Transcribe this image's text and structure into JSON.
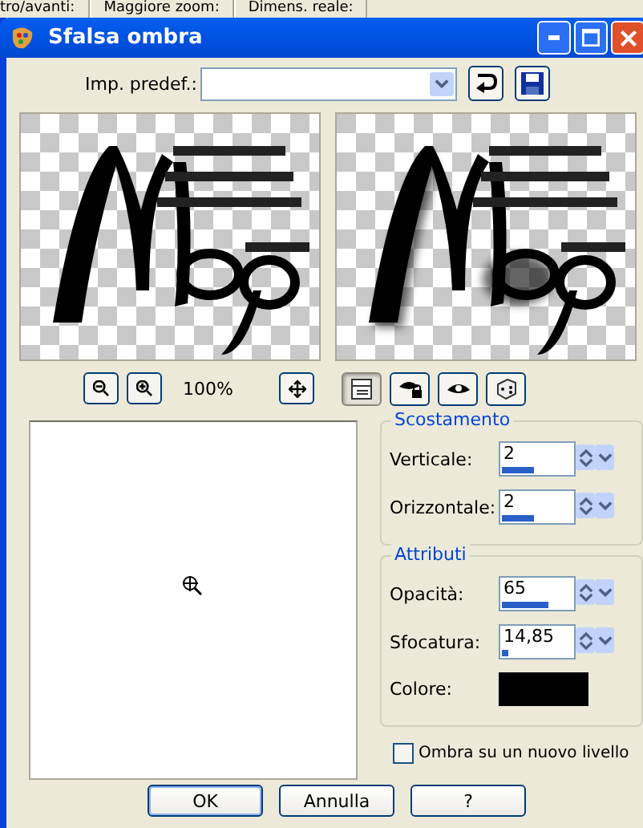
{
  "background_toolbar": [
    "tro/avanti:",
    "Maggiore zoom:",
    "Dimens. reale:"
  ],
  "window": {
    "title": "Sfalsa ombra"
  },
  "preset": {
    "label": "Imp. predef.:"
  },
  "previews": [
    {
      "kind": "picture",
      "shadow": false
    },
    {
      "kind": "picture",
      "shadow": true
    }
  ],
  "zoom": "100%",
  "view_buttons": [
    {
      "selected": true
    },
    {
      "selected": false
    },
    {
      "selected": false
    },
    {
      "selected": false
    }
  ],
  "groups": [
    {
      "title": "Scostamento",
      "rows": [
        {
          "kind": "spin",
          "label": "Verticale:",
          "value": "2",
          "level": 0.45
        },
        {
          "kind": "spin",
          "label": "Orizzontale:",
          "value": "2",
          "level": 0.45
        }
      ]
    },
    {
      "title": "Attributi",
      "rows": [
        {
          "kind": "spin",
          "label": "Opacità:",
          "value": "65",
          "level": 0.65
        },
        {
          "kind": "spin",
          "label": "Sfocatura:",
          "value": "14,85",
          "level": 0.1
        },
        {
          "kind": "color",
          "label": "Colore:",
          "color": "#000000"
        }
      ]
    }
  ],
  "checkbox": {
    "label": "Ombra su un nuovo livello",
    "checked": false
  },
  "buttons": [
    {
      "label": "OK",
      "default": true
    },
    {
      "label": "Annulla",
      "default": false
    },
    {
      "label": "?",
      "default": false
    }
  ]
}
